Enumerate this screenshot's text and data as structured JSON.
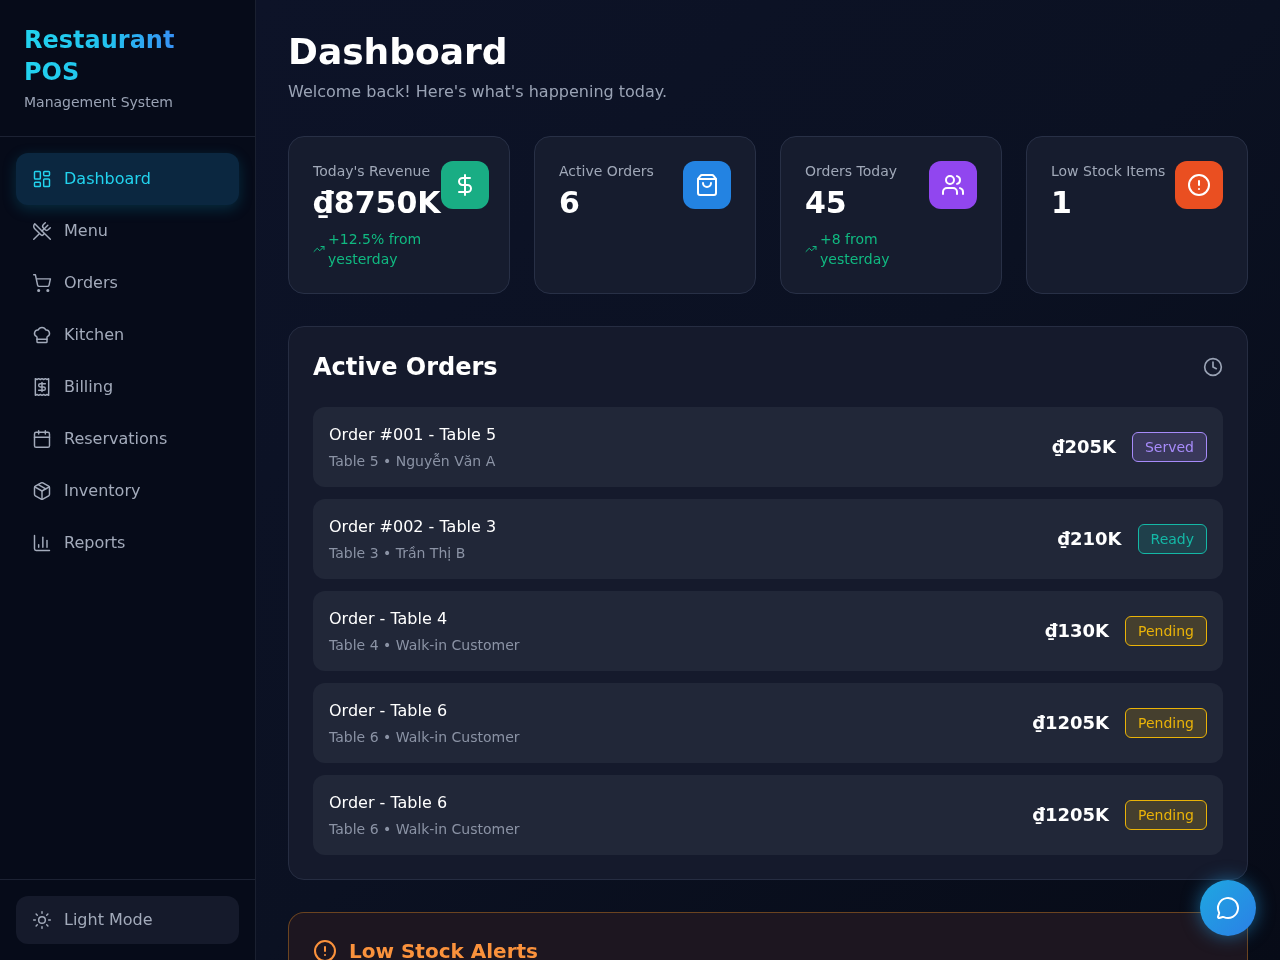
{
  "sidebar": {
    "title": "Restaurant POS",
    "subtitle": "Management System",
    "items": [
      {
        "label": "Dashboard",
        "selected": true
      },
      {
        "label": "Menu",
        "selected": false
      },
      {
        "label": "Orders",
        "selected": false
      },
      {
        "label": "Kitchen",
        "selected": false
      },
      {
        "label": "Billing",
        "selected": false
      },
      {
        "label": "Reservations",
        "selected": false
      },
      {
        "label": "Inventory",
        "selected": false
      },
      {
        "label": "Reports",
        "selected": false
      }
    ],
    "theme_toggle": {
      "label": "Light Mode"
    }
  },
  "header": {
    "title": "Dashboard",
    "subtitle": "Welcome back! Here's what's happening today."
  },
  "stats": [
    {
      "label": "Today's Revenue",
      "value": "₫8750K",
      "trend": "+12.5% from yesterday",
      "color": "#19ad84"
    },
    {
      "label": "Active Orders",
      "value": "6",
      "color": "#2383e2"
    },
    {
      "label": "Orders Today",
      "value": "45",
      "trend": "+8 from yesterday",
      "color": "#9146ef"
    },
    {
      "label": "Low Stock Items",
      "value": "1",
      "color": "#ea4f21"
    }
  ],
  "active_orders": {
    "title": "Active Orders",
    "items": [
      {
        "title": "Order #001 - Table 5",
        "detail": "Table 5 • Nguyễn Văn A",
        "amount": "₫205K",
        "status": "Served",
        "color": "#a78bfa"
      },
      {
        "title": "Order #002 - Table 3",
        "detail": "Table 3 • Trần Thị B",
        "amount": "₫210K",
        "status": "Ready",
        "color": "#14b8a6"
      },
      {
        "title": "Order - Table 4",
        "detail": "Table 4 • Walk-in Customer",
        "amount": "₫130K",
        "status": "Pending",
        "color": "#eab308"
      },
      {
        "title": "Order - Table 6",
        "detail": "Table 6 • Walk-in Customer",
        "amount": "₫1205K",
        "status": "Pending",
        "color": "#eab308"
      },
      {
        "title": "Order - Table 6",
        "detail": "Table 6 • Walk-in Customer",
        "amount": "₫1205K",
        "status": "Pending",
        "color": "#eab308"
      }
    ]
  },
  "low_stock_alerts": {
    "title": "Low Stock Alerts"
  }
}
